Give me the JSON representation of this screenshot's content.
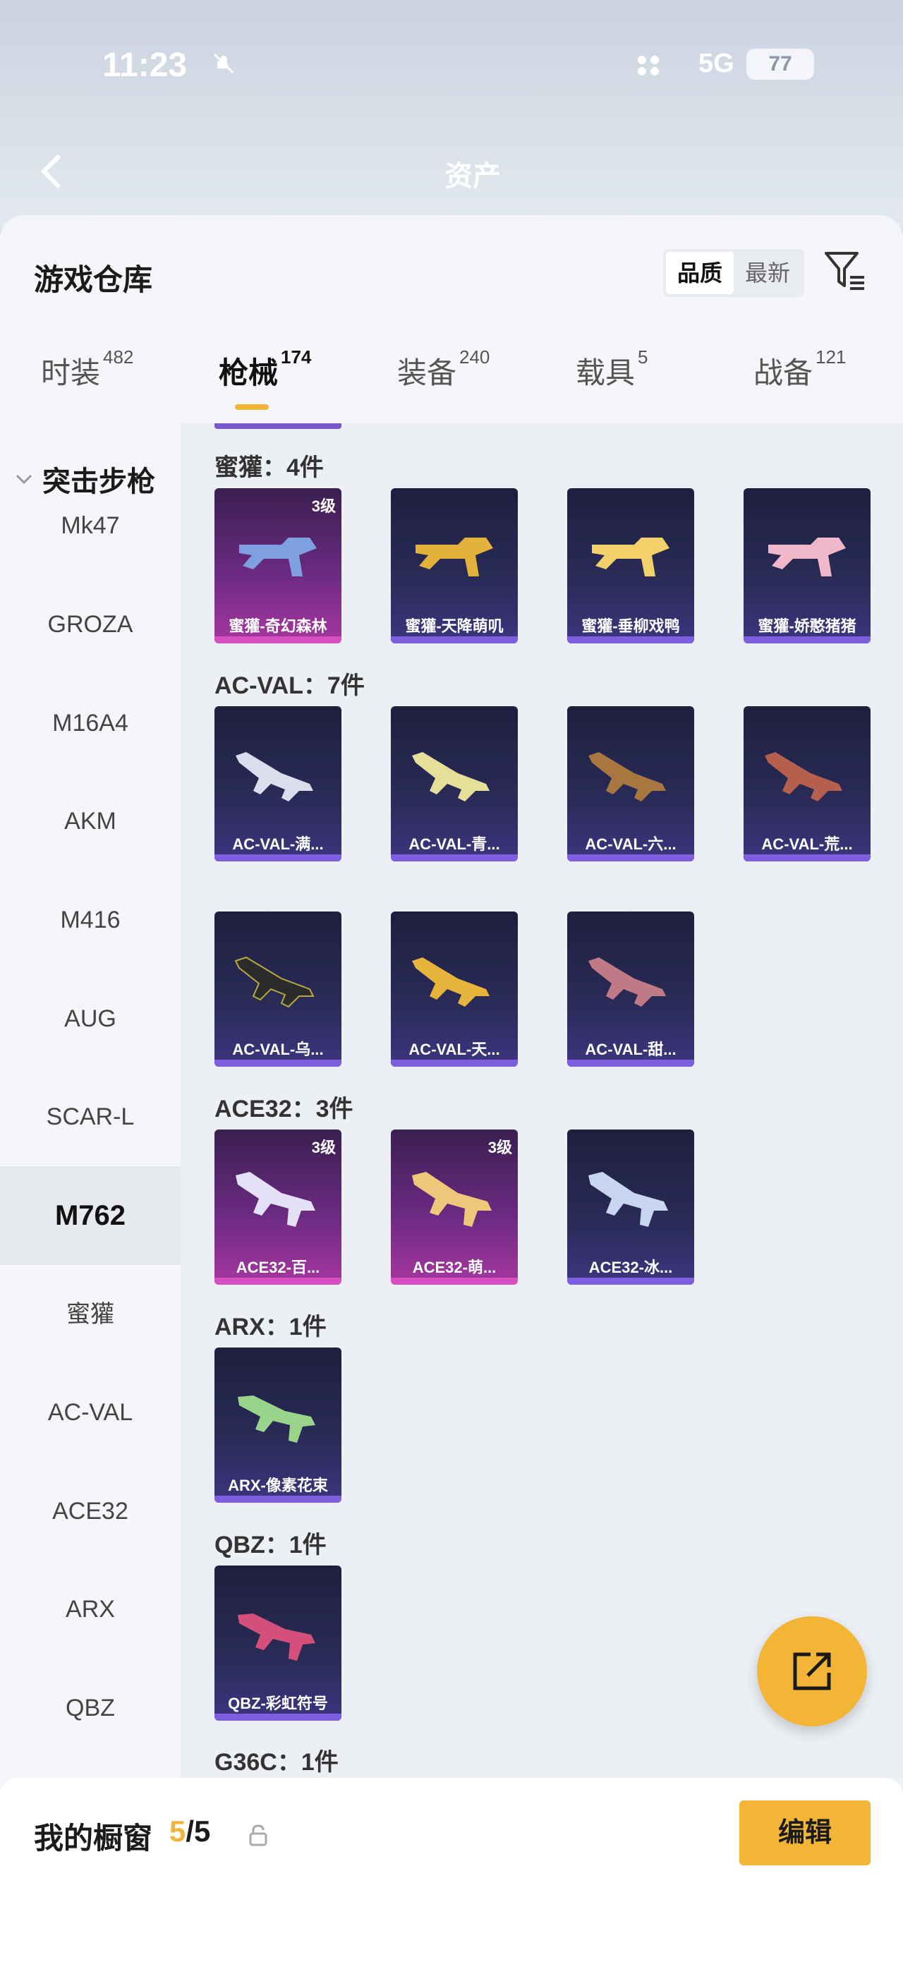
{
  "status": {
    "time": "11:23",
    "network": "5G",
    "battery": "77"
  },
  "nav": {
    "title": "资产"
  },
  "sheet": {
    "title": "游戏仓库",
    "sort": {
      "quality": "品质",
      "newest": "最新"
    }
  },
  "tabs": [
    {
      "label": "时装",
      "count": "482"
    },
    {
      "label": "枪械",
      "count": "174"
    },
    {
      "label": "装备",
      "count": "240"
    },
    {
      "label": "载具",
      "count": "5"
    },
    {
      "label": "战备",
      "count": "121"
    }
  ],
  "sidebar": {
    "header": "突击步枪",
    "items": [
      "Mk47",
      "GROZA",
      "M16A4",
      "AKM",
      "M416",
      "AUG",
      "SCAR-L",
      "M762",
      "蜜獾",
      "AC-VAL",
      "ACE32",
      "ARX",
      "QBZ"
    ]
  },
  "groups": [
    {
      "title": "蜜獾：4件",
      "items": [
        {
          "name": "蜜獾-奇幻森林",
          "level": "3级"
        },
        {
          "name": "蜜獾-天降萌叽"
        },
        {
          "name": "蜜獾-垂柳戏鸭"
        },
        {
          "name": "蜜獾-娇憨猪猪"
        }
      ]
    },
    {
      "title": "AC-VAL：7件",
      "items": [
        {
          "name": "AC-VAL-满..."
        },
        {
          "name": "AC-VAL-青..."
        },
        {
          "name": "AC-VAL-六..."
        },
        {
          "name": "AC-VAL-荒..."
        },
        {
          "name": "AC-VAL-乌..."
        },
        {
          "name": "AC-VAL-天..."
        },
        {
          "name": "AC-VAL-甜..."
        }
      ]
    },
    {
      "title": "ACE32：3件",
      "items": [
        {
          "name": "ACE32-百...",
          "level": "3级"
        },
        {
          "name": "ACE32-萌...",
          "level": "3级"
        },
        {
          "name": "ACE32-冰..."
        }
      ]
    },
    {
      "title": "ARX：1件",
      "items": [
        {
          "name": "ARX-像素花束"
        }
      ]
    },
    {
      "title": "QBZ：1件",
      "items": [
        {
          "name": "QBZ-彩虹符号"
        }
      ]
    },
    {
      "title": "G36C：1件"
    }
  ],
  "bottom": {
    "title": "我的橱窗",
    "count_current": "5",
    "count_total": "/5",
    "edit": "编辑"
  },
  "colors": {
    "accent": "#f2b535",
    "card_purple": "#2a2b58",
    "card_pink": "#a6379f"
  }
}
